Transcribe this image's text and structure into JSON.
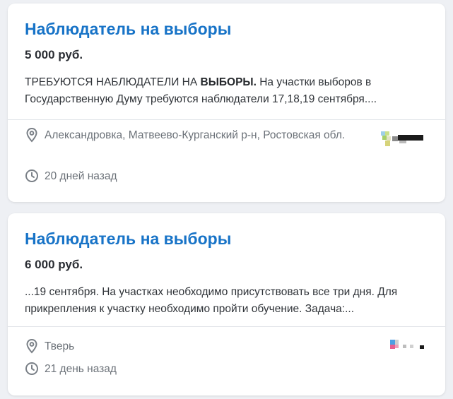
{
  "colors": {
    "background": "#eef0f4",
    "card": "#ffffff",
    "title": "#1773c7",
    "text": "#2f3338",
    "meta": "#6b7178"
  },
  "icons": {
    "location": "location-pin-icon",
    "time": "clock-icon"
  },
  "listings": [
    {
      "title": "Наблюдатель на выборы",
      "salary": "5 000 руб.",
      "snippet_before": "ТРЕБУЮТСЯ НАБЛЮДАТЕЛИ НА ",
      "snippet_bold": "ВЫБОРЫ.",
      "snippet_after": " На участки выборов в Государственную Думу требуются наблюдатели 17,18,19 сентября....",
      "location": "Александровка, Матвеево-Курганский р-н, Ростовская обл.",
      "posted": "20 дней назад"
    },
    {
      "title": "Наблюдатель на выборы",
      "salary": "6 000 руб.",
      "snippet": " ...19 сентября. На участках необходимо присутствовать все три дня. Для прикрепления к участку необходимо пройти обучение. Задача:...",
      "location": "Тверь",
      "posted": "21 день назад"
    }
  ]
}
